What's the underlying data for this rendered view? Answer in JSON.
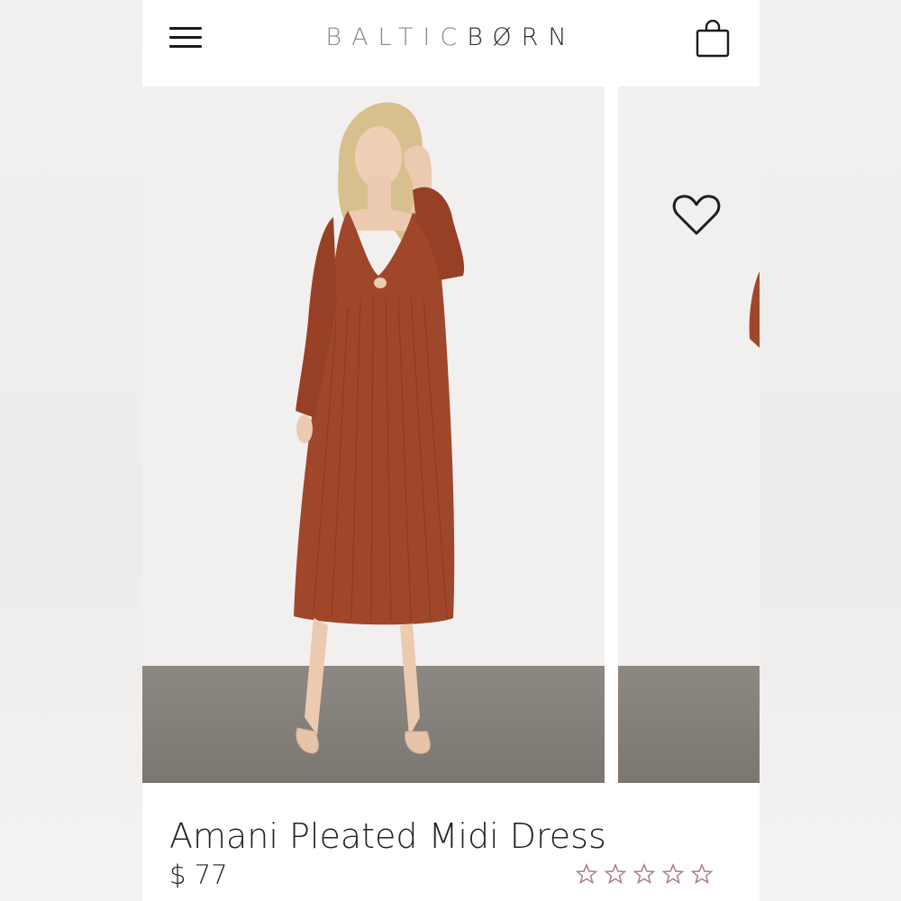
{
  "header": {
    "logo_part1": "BALTIC",
    "logo_part2": "BØRN",
    "menu_icon": "hamburger-menu-icon",
    "cart_icon": "shopping-bag-icon"
  },
  "carousel": {
    "favorite_icon": "heart-icon"
  },
  "product": {
    "title": "Amani Pleated Midi Dress",
    "price": "$ 77",
    "rating": {
      "max": 5,
      "filled": 0,
      "icon": "star-outline-icon",
      "color": "#b07a86"
    }
  },
  "colors": {
    "dress": "#a0462a",
    "text": "#222222",
    "logo_light": "#8a8a8a",
    "logo_dark": "#2a2a2a"
  }
}
